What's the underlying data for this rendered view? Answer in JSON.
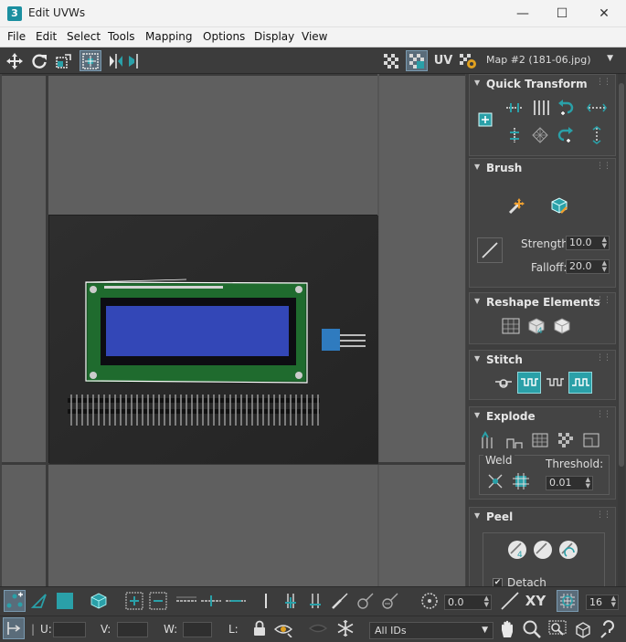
{
  "window": {
    "app_icon": "3",
    "title": "Edit UVWs",
    "minimize": "—",
    "maximize": "☐",
    "close": "✕"
  },
  "menu": [
    "File",
    "Edit",
    "Select",
    "Tools",
    "Mapping",
    "Options",
    "Display",
    "View"
  ],
  "toolbar": {
    "uv_label": "UV",
    "map_select": "Map #2 (181-06.jpg)"
  },
  "panel": {
    "quick_transform": {
      "title": "Quick Transform"
    },
    "brush": {
      "title": "Brush",
      "strength_label": "Strength:",
      "strength_value": "10.0",
      "falloff_label": "Falloff:",
      "falloff_value": "20.0"
    },
    "reshape": {
      "title": "Reshape Elements"
    },
    "stitch": {
      "title": "Stitch"
    },
    "explode": {
      "title": "Explode",
      "weld_label": "Weld",
      "threshold_label": "Threshold:",
      "threshold_value": "0.01"
    },
    "peel": {
      "title": "Peel",
      "detach_label": "Detach",
      "detach_checked": true
    }
  },
  "bottom": {
    "angle_value": "0.0",
    "xy_label": "XY",
    "grid_value": "16",
    "u_label": "U:",
    "u_value": "",
    "v_label": "V:",
    "v_value": "",
    "w_label": "W:",
    "w_value": "",
    "l_label": "L:",
    "ids_select": "All IDs"
  },
  "colors": {
    "accent": "#2aa0a8",
    "viewport_bg": "#5f5f5f",
    "panel_bg": "#3e3e3e"
  }
}
